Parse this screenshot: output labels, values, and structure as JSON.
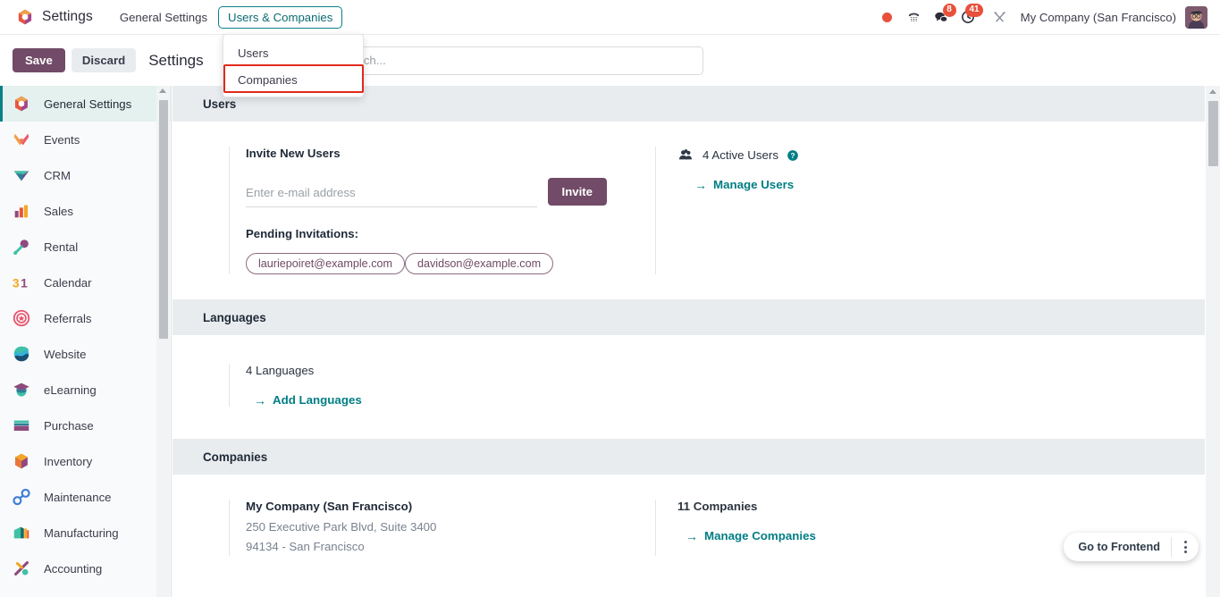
{
  "navbar": {
    "brand": "Settings",
    "brand_icon": "odoo-logo-icon",
    "menus": [
      {
        "label": "General Settings",
        "active": false
      },
      {
        "label": "Users & Companies",
        "active": true
      }
    ],
    "systray": {
      "record_icon": "record-dot-icon",
      "voip_icon": "phone-keypad-icon",
      "messages_icon": "chat-bubble-icon",
      "messages_count": "8",
      "activities_icon": "clock-icon",
      "activities_count": "41",
      "tools_icon": "tools-icon",
      "company": "My Company (San Francisco)",
      "avatar_icon": "user-avatar"
    }
  },
  "dropdown": {
    "items": [
      {
        "label": "Users",
        "highlighted": false
      },
      {
        "label": "Companies",
        "highlighted": true
      }
    ]
  },
  "control_panel": {
    "save_label": "Save",
    "discard_label": "Discard",
    "title": "Settings",
    "search_icon": "search-icon",
    "search_placeholder": "Search...",
    "search_value": ""
  },
  "sidebar": {
    "items": [
      {
        "label": "General Settings",
        "icon": "settings-gear-icon",
        "selected": true
      },
      {
        "label": "Events",
        "icon": "events-icon",
        "selected": false
      },
      {
        "label": "CRM",
        "icon": "crm-icon",
        "selected": false
      },
      {
        "label": "Sales",
        "icon": "sales-chart-icon",
        "selected": false
      },
      {
        "label": "Rental",
        "icon": "rental-key-icon",
        "selected": false
      },
      {
        "label": "Calendar",
        "icon": "calendar-31-icon",
        "selected": false
      },
      {
        "label": "Referrals",
        "icon": "referrals-badge-icon",
        "selected": false
      },
      {
        "label": "Website",
        "icon": "website-globe-icon",
        "selected": false
      },
      {
        "label": "eLearning",
        "icon": "elearning-cap-icon",
        "selected": false
      },
      {
        "label": "Purchase",
        "icon": "purchase-icon",
        "selected": false
      },
      {
        "label": "Inventory",
        "icon": "inventory-box-icon",
        "selected": false
      },
      {
        "label": "Maintenance",
        "icon": "maintenance-wrench-icon",
        "selected": false
      },
      {
        "label": "Manufacturing",
        "icon": "manufacturing-icon",
        "selected": false
      },
      {
        "label": "Accounting",
        "icon": "accounting-icon",
        "selected": false
      }
    ]
  },
  "sections": {
    "users": {
      "title": "Users",
      "invite_title": "Invite New Users",
      "invite_placeholder": "Enter e-mail address",
      "invite_value": "",
      "invite_button": "Invite",
      "pending_label": "Pending Invitations:",
      "pending": [
        "lauriepoiret@example.com",
        "davidson@example.com"
      ],
      "active_users_icon": "users-group-icon",
      "active_users": "4 Active Users",
      "help_icon": "help-circle-icon",
      "manage_link": "Manage Users",
      "arrow_icon": "arrow-right-icon"
    },
    "languages": {
      "title": "Languages",
      "count": "4 Languages",
      "add_link": "Add Languages",
      "arrow_icon": "arrow-right-icon"
    },
    "companies": {
      "title": "Companies",
      "company_name": "My Company (San Francisco)",
      "address_line1": "250 Executive Park Blvd, Suite 3400",
      "address_line2": "94134 - San Francisco",
      "count": "11 Companies",
      "manage_link": "Manage Companies",
      "arrow_icon": "arrow-right-icon"
    }
  },
  "frontend_pill": {
    "label": "Go to Frontend",
    "menu_icon": "vertical-dots-icon"
  },
  "colors": {
    "accent_purple": "#714b67",
    "accent_teal": "#017e84",
    "badge_red": "#e8503a",
    "highlight_red": "#e02a1b",
    "section_header_bg": "#e9ecef"
  }
}
